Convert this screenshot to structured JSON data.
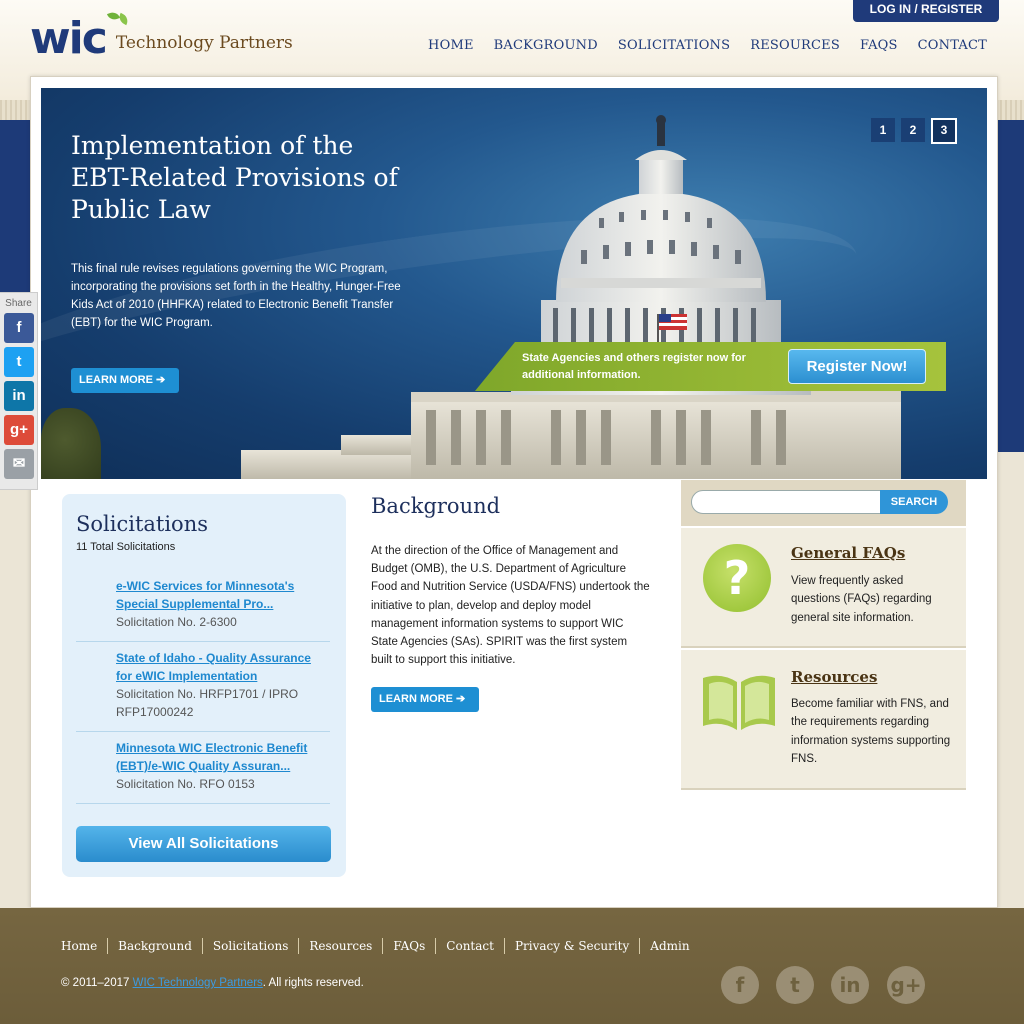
{
  "header": {
    "logo_mark": "wic",
    "logo_text": "Technology Partners",
    "login_label": "LOG IN / REGISTER",
    "nav": [
      "HOME",
      "BACKGROUND",
      "SOLICITATIONS",
      "RESOURCES",
      "FAQS",
      "CONTACT"
    ]
  },
  "hero": {
    "title": "Implementation of the EBT-Related Provisions of Public Law",
    "body": "This final rule revises regulations governing the WIC Program, incorporating the provisions set forth in the Healthy, Hunger-Free Kids Act of 2010 (HHFKA) related to Electronic Benefit Transfer (EBT) for the WIC Program.",
    "learn_more": "LEARN MORE",
    "pager": [
      "1",
      "2",
      "3"
    ],
    "active_page": "3",
    "register_text": "State Agencies and others register now for additional information.",
    "register_button": "Register Now!"
  },
  "share": {
    "label": "Share",
    "buttons": [
      {
        "name": "facebook-icon",
        "glyph": "f",
        "color": "#3b5998"
      },
      {
        "name": "twitter-icon",
        "glyph": "t",
        "color": "#1da1f2"
      },
      {
        "name": "linkedin-icon",
        "glyph": "in",
        "color": "#0e76a8"
      },
      {
        "name": "google-plus-icon",
        "glyph": "g+",
        "color": "#dd4b39"
      },
      {
        "name": "email-icon",
        "glyph": "✉",
        "color": "#9aa0a6"
      }
    ]
  },
  "solicitations": {
    "title": "Solicitations",
    "count": "11 Total Solicitations",
    "items": [
      {
        "title": "e-WIC Services for Minnesota's Special Supplemental Pro...",
        "number": "Solicitation No. 2-6300"
      },
      {
        "title": "State of Idaho - Quality Assurance for eWIC Implementation",
        "number": "Solicitation No. HRFP1701 / IPRO RFP17000242"
      },
      {
        "title": "Minnesota WIC Electronic Benefit (EBT)/e-WIC Quality Assuran...",
        "number": "Solicitation No. RFO 0153"
      }
    ],
    "view_all": "View All Solicitations"
  },
  "background": {
    "title": "Background",
    "body": "At the direction of the Office of Management and Budget (OMB), the U.S. Department of Agriculture Food and Nutrition Service (USDA/FNS) undertook the initiative to plan, develop and deploy model management information systems to support WIC State Agencies (SAs). SPIRIT was the first system built to support this initiative.",
    "learn_more": "LEARN MORE"
  },
  "search": {
    "placeholder": "",
    "button": "SEARCH"
  },
  "faq_panel": {
    "title": "General FAQs",
    "text": "View frequently asked questions (FAQs) regarding general site information."
  },
  "resources_panel": {
    "title": "Resources",
    "text": "Become familiar with FNS, and the requirements regarding information systems supporting FNS."
  },
  "footer": {
    "nav": [
      "Home",
      "Background",
      "Solicitations",
      "Resources",
      "FAQs",
      "Contact",
      "Privacy & Security",
      "Admin"
    ],
    "copyright_prefix": "© 2011–2017",
    "copyright_link": "WIC Technology Partners",
    "copyright_suffix": ". All rights reserved.",
    "social": [
      {
        "name": "facebook-icon",
        "glyph": "f"
      },
      {
        "name": "twitter-icon",
        "glyph": "t"
      },
      {
        "name": "linkedin-icon",
        "glyph": "in"
      },
      {
        "name": "google-plus-icon",
        "glyph": "g+"
      }
    ]
  },
  "colors": {
    "brand_blue": "#1f3a7a",
    "accent_blue": "#1e88cf",
    "accent_green": "#92bf2e",
    "footer_brown": "#766641"
  }
}
